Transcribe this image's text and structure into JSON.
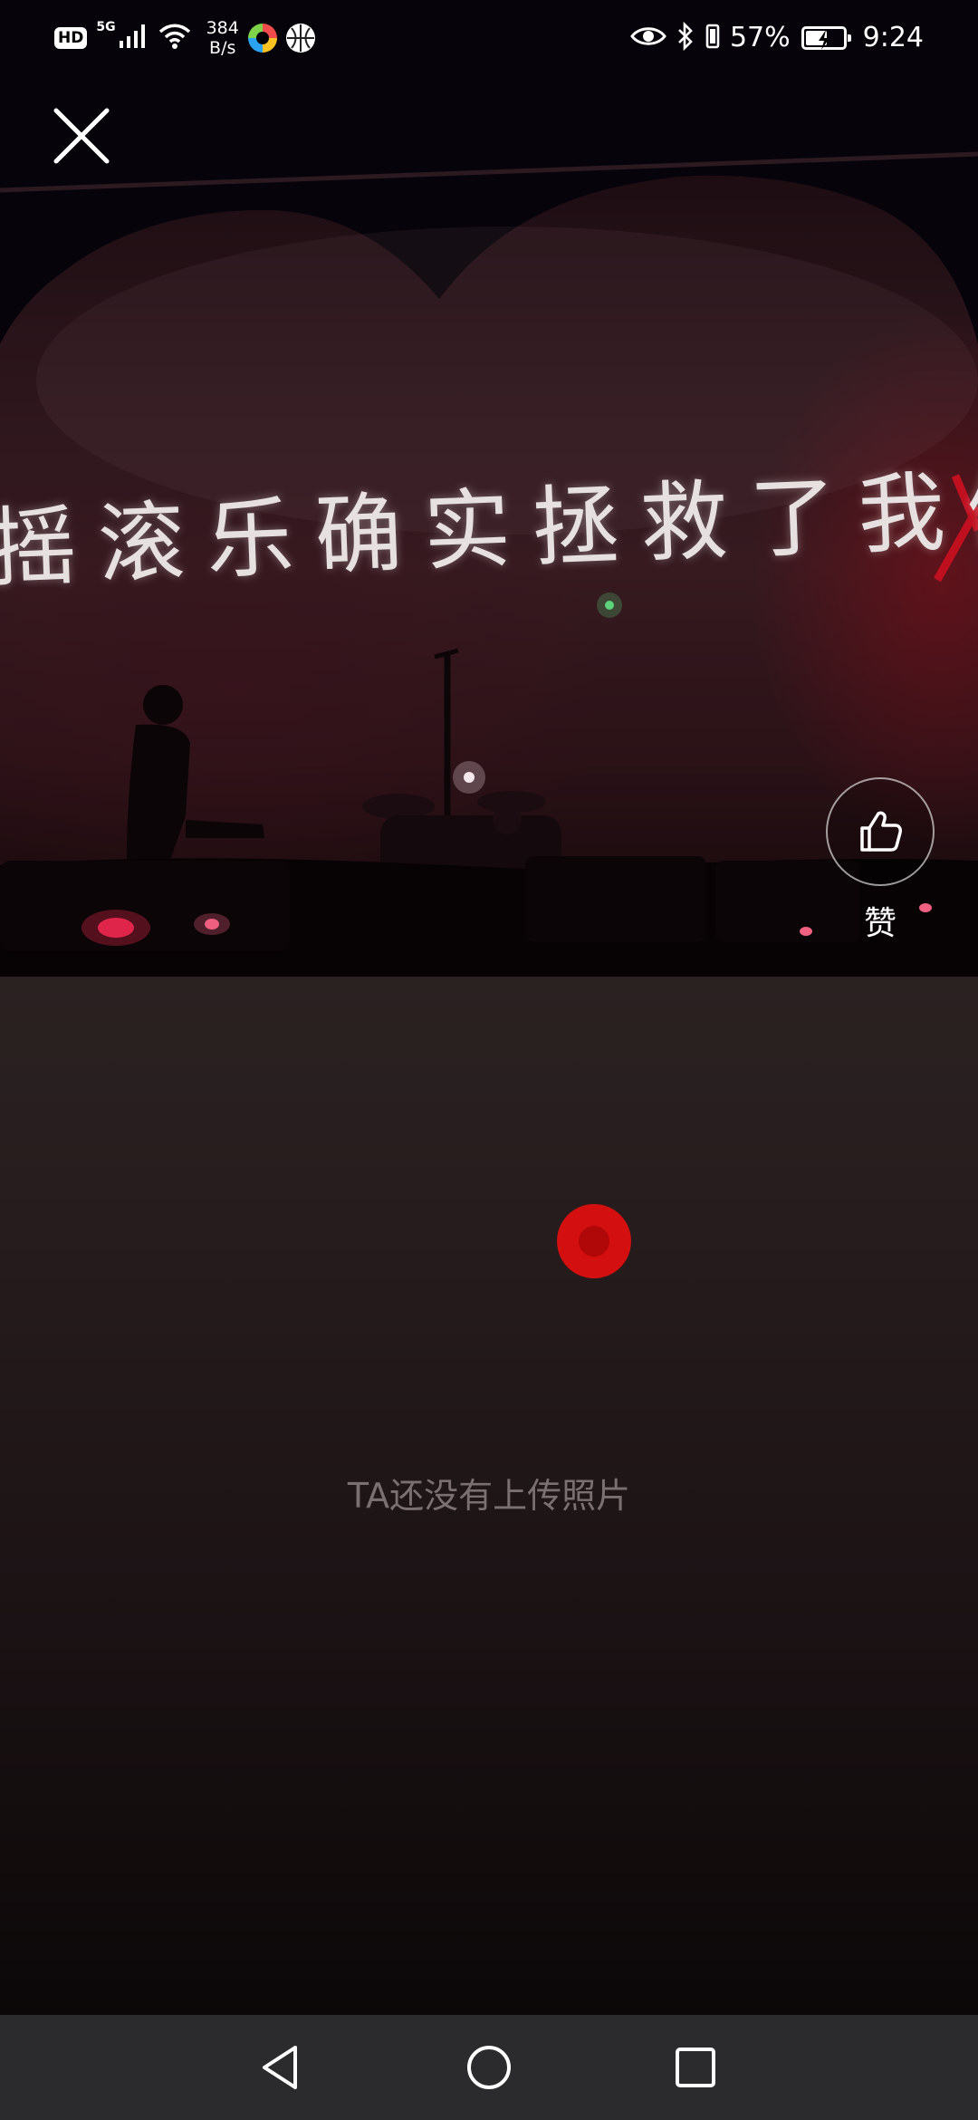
{
  "status_bar": {
    "hd_label": "HD",
    "network_generation": "5G",
    "speed_value": "384",
    "speed_unit": "B/s",
    "battery_percent": "57%",
    "battery_level": 0.57,
    "time": "9:24",
    "icons": [
      "signal-icon",
      "wifi-icon",
      "app-notification-icon",
      "basketball-app-icon",
      "eye-icon",
      "bluetooth-icon",
      "vibrate-icon",
      "battery-icon"
    ]
  },
  "photo": {
    "lyrics_text": "摇滚乐确实拯救了我们"
  },
  "actions": {
    "close_icon": "close-icon",
    "like_icon": "thumbs-up-icon",
    "like_label": "赞"
  },
  "empty_state": {
    "message": "TA还没有上传照片"
  },
  "nav_bar": {
    "icons": [
      "back-icon",
      "home-icon",
      "recents-icon"
    ]
  },
  "colors": {
    "accent_red": "#d40f0f",
    "nav_background": "#2b2b2d",
    "empty_text": "#7a7071"
  }
}
